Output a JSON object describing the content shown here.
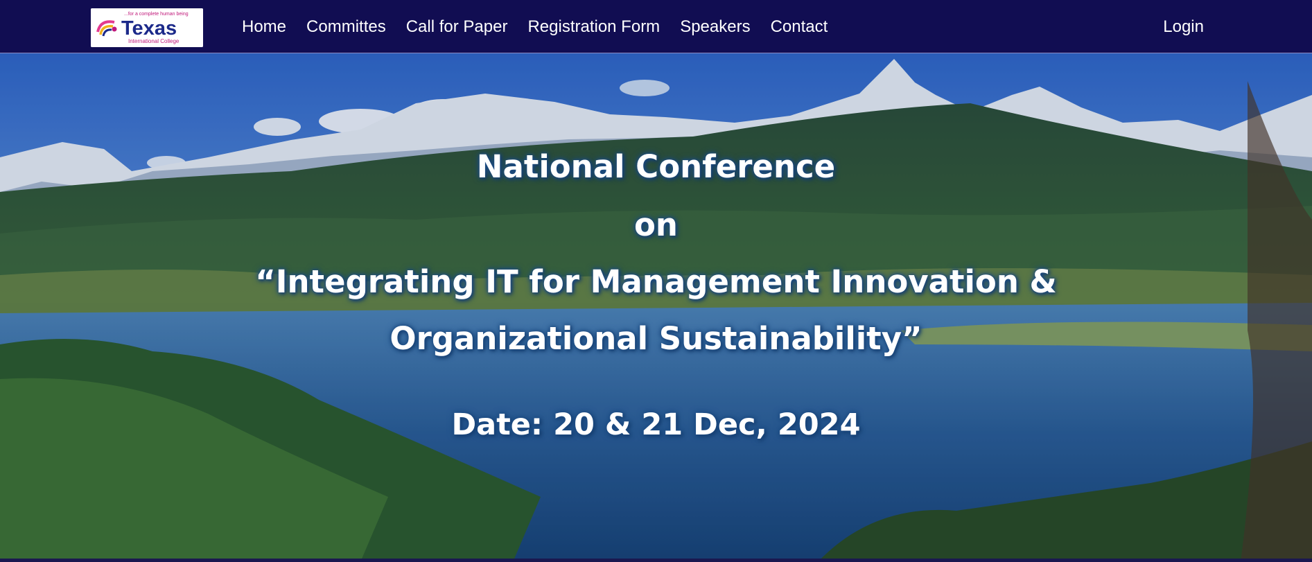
{
  "nav": {
    "logo_tagline": "...for a complete human being",
    "logo_name": "Texas",
    "logo_sub": "International College",
    "links": [
      "Home",
      "Committes",
      "Call for Paper",
      "Registration Form",
      "Speakers",
      "Contact"
    ],
    "login": "Login"
  },
  "hero": {
    "line1": "National Conference",
    "line2": "on",
    "line3": "“Integrating IT for Management Innovation &",
    "line4": "Organizational Sustainability”",
    "date": "Date: 20 & 21 Dec, 2024"
  },
  "colors": {
    "navbar_bg": "#110d52",
    "text": "#ffffff",
    "logo_accent": "#c0187a",
    "logo_blue": "#1c2a8a"
  }
}
